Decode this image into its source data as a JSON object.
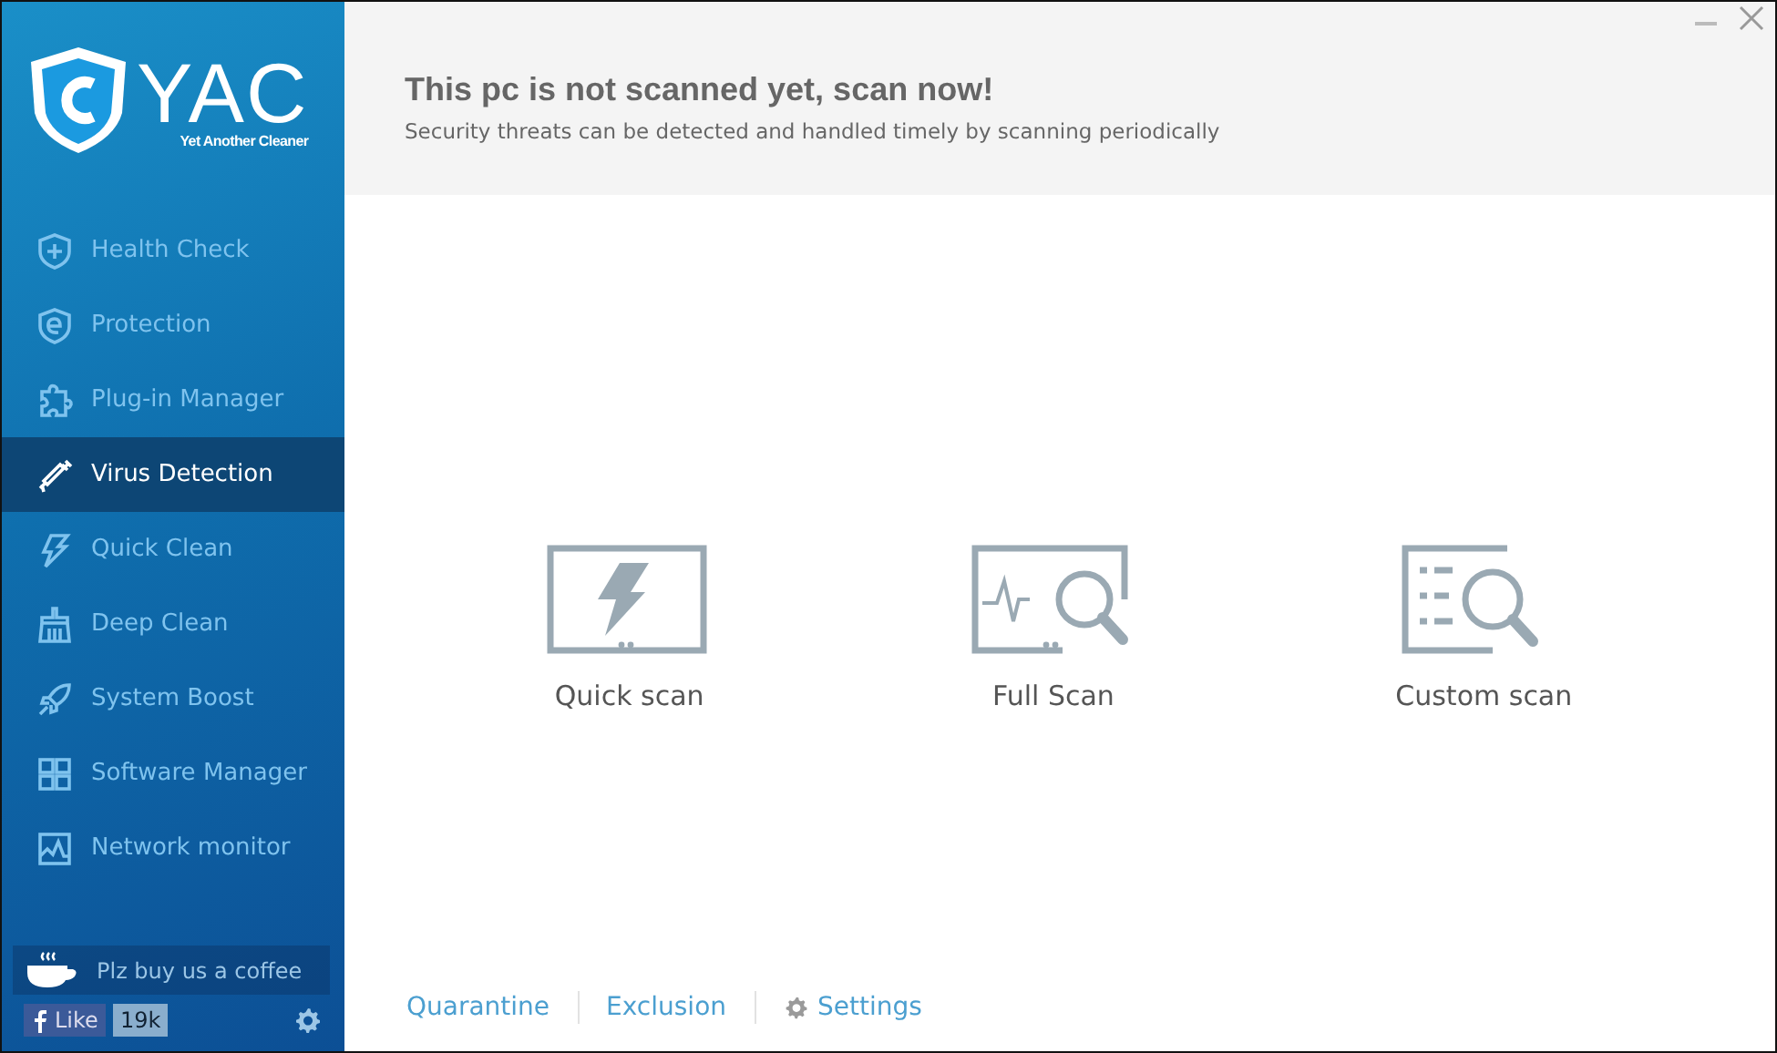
{
  "logo": {
    "name": "YAC",
    "tagline": "Yet Another Cleaner"
  },
  "sidebar": {
    "items": [
      {
        "label": "Health Check",
        "selected": false
      },
      {
        "label": "Protection",
        "selected": false
      },
      {
        "label": "Plug-in Manager",
        "selected": false
      },
      {
        "label": "Virus Detection",
        "selected": true
      },
      {
        "label": "Quick Clean",
        "selected": false
      },
      {
        "label": "Deep Clean",
        "selected": false
      },
      {
        "label": "System Boost",
        "selected": false
      },
      {
        "label": "Software Manager",
        "selected": false
      },
      {
        "label": "Network monitor",
        "selected": false
      }
    ],
    "coffee": "Plz buy us a coffee",
    "like": {
      "label": "Like",
      "count": "19k"
    }
  },
  "header": {
    "title": "This pc is not scanned yet, scan now!",
    "subtitle": "Security threats can be detected and handled timely by scanning periodically"
  },
  "scans": [
    {
      "kind": "quick",
      "label": "Quick scan"
    },
    {
      "kind": "full",
      "label": "Full Scan"
    },
    {
      "kind": "custom",
      "label": "Custom scan"
    }
  ],
  "footer_links": [
    {
      "label": "Quarantine",
      "kind": "plain"
    },
    {
      "label": "Exclusion",
      "kind": "plain"
    },
    {
      "label": "Settings",
      "kind": "gear"
    }
  ]
}
